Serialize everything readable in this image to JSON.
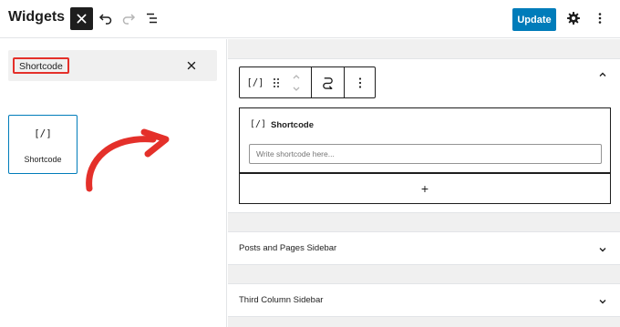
{
  "header": {
    "title": "Widgets",
    "update_label": "Update",
    "icons": [
      "close-icon",
      "undo-icon",
      "redo-icon",
      "list-view-icon",
      "gear-icon",
      "more-vertical-icon"
    ]
  },
  "inserter": {
    "search_value": "Shortcode",
    "result_block": {
      "icon_text": "[/]",
      "label": "Shortcode"
    }
  },
  "editor": {
    "active_area": {
      "toolbar_icon_text": "[/]",
      "block": {
        "icon_text": "[/]",
        "title": "Shortcode",
        "input_placeholder": "Write shortcode here..."
      },
      "add_block_symbol": "+"
    },
    "areas": [
      {
        "label": "Posts and Pages Sidebar"
      },
      {
        "label": "Third Column Sidebar"
      }
    ]
  },
  "colors": {
    "accent": "#007cba",
    "highlight": "#e4302a",
    "dark": "#1e1e1e"
  }
}
